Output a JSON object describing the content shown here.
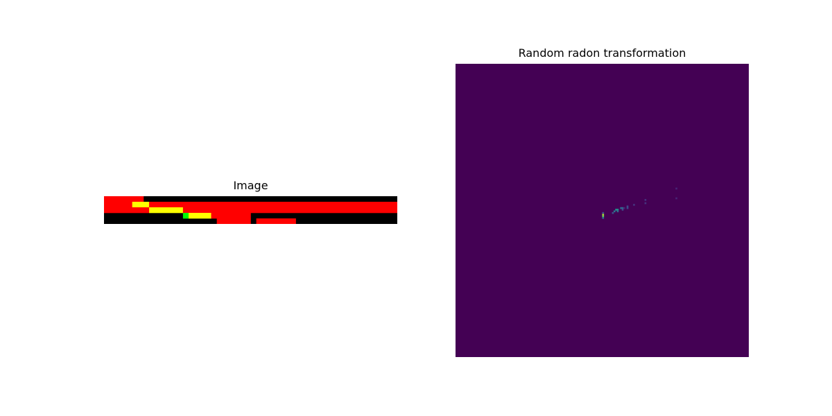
{
  "figure": {
    "panels": [
      {
        "title": "Image"
      },
      {
        "title": "Random radon transformation"
      }
    ]
  },
  "chart_data": [
    {
      "type": "heatmap",
      "title": "Image",
      "cols": 52,
      "rows": 5,
      "axes_visible": false,
      "palette": [
        "#000000",
        "#ff0000",
        "#ffff00",
        "#00ff00"
      ],
      "cells": [
        {
          "row": 0,
          "col": 0,
          "span": 7,
          "value": 1
        },
        {
          "row": 1,
          "col": 0,
          "span": 5,
          "value": 1
        },
        {
          "row": 1,
          "col": 5,
          "span": 3,
          "value": 2
        },
        {
          "row": 1,
          "col": 8,
          "span": 44,
          "value": 1
        },
        {
          "row": 2,
          "col": 0,
          "span": 8,
          "value": 1
        },
        {
          "row": 2,
          "col": 8,
          "span": 6,
          "value": 2
        },
        {
          "row": 2,
          "col": 14,
          "span": 38,
          "value": 1
        },
        {
          "row": 3,
          "col": 14,
          "span": 1,
          "value": 3
        },
        {
          "row": 3,
          "col": 15,
          "span": 4,
          "value": 2
        },
        {
          "row": 3,
          "col": 19,
          "span": 7,
          "value": 1
        },
        {
          "row": 4,
          "col": 20,
          "span": 6,
          "value": 1
        },
        {
          "row": 4,
          "col": 27,
          "span": 7,
          "value": 1
        }
      ]
    },
    {
      "type": "heatmap",
      "title": "Random radon transformation",
      "cols": 180,
      "rows": 180,
      "axes_visible": false,
      "background": "#440154",
      "cells": [
        {
          "row": 92,
          "col": 90,
          "span": 1,
          "value": "#b5de2b"
        },
        {
          "row": 93,
          "col": 90,
          "span": 1,
          "value": "#6ece58"
        },
        {
          "row": 94,
          "col": 90,
          "span": 1,
          "value": "#2a788e"
        },
        {
          "row": 91,
          "col": 90,
          "span": 1,
          "value": "#3b528b"
        },
        {
          "row": 91,
          "col": 96,
          "span": 1,
          "value": "#3b528b"
        },
        {
          "row": 90,
          "col": 97,
          "span": 1,
          "value": "#2a788e"
        },
        {
          "row": 89,
          "col": 98,
          "span": 2,
          "value": "#21918c"
        },
        {
          "row": 90,
          "col": 99,
          "span": 1,
          "value": "#31688e"
        },
        {
          "row": 88,
          "col": 101,
          "span": 2,
          "value": "#31688e"
        },
        {
          "row": 89,
          "col": 102,
          "span": 1,
          "value": "#3e4989"
        },
        {
          "row": 88,
          "col": 103,
          "span": 1,
          "value": "#482878"
        },
        {
          "row": 87,
          "col": 105,
          "span": 1,
          "value": "#3e4989"
        },
        {
          "row": 88,
          "col": 105,
          "span": 1,
          "value": "#3e4989"
        },
        {
          "row": 86,
          "col": 109,
          "span": 1,
          "value": "#46337e"
        },
        {
          "row": 85,
          "col": 116,
          "span": 1,
          "value": "#46327e"
        },
        {
          "row": 83,
          "col": 116,
          "span": 1,
          "value": "#46327e"
        },
        {
          "row": 76,
          "col": 135,
          "span": 1,
          "value": "#482475"
        },
        {
          "row": 82,
          "col": 135,
          "span": 1,
          "value": "#482475"
        }
      ]
    }
  ]
}
